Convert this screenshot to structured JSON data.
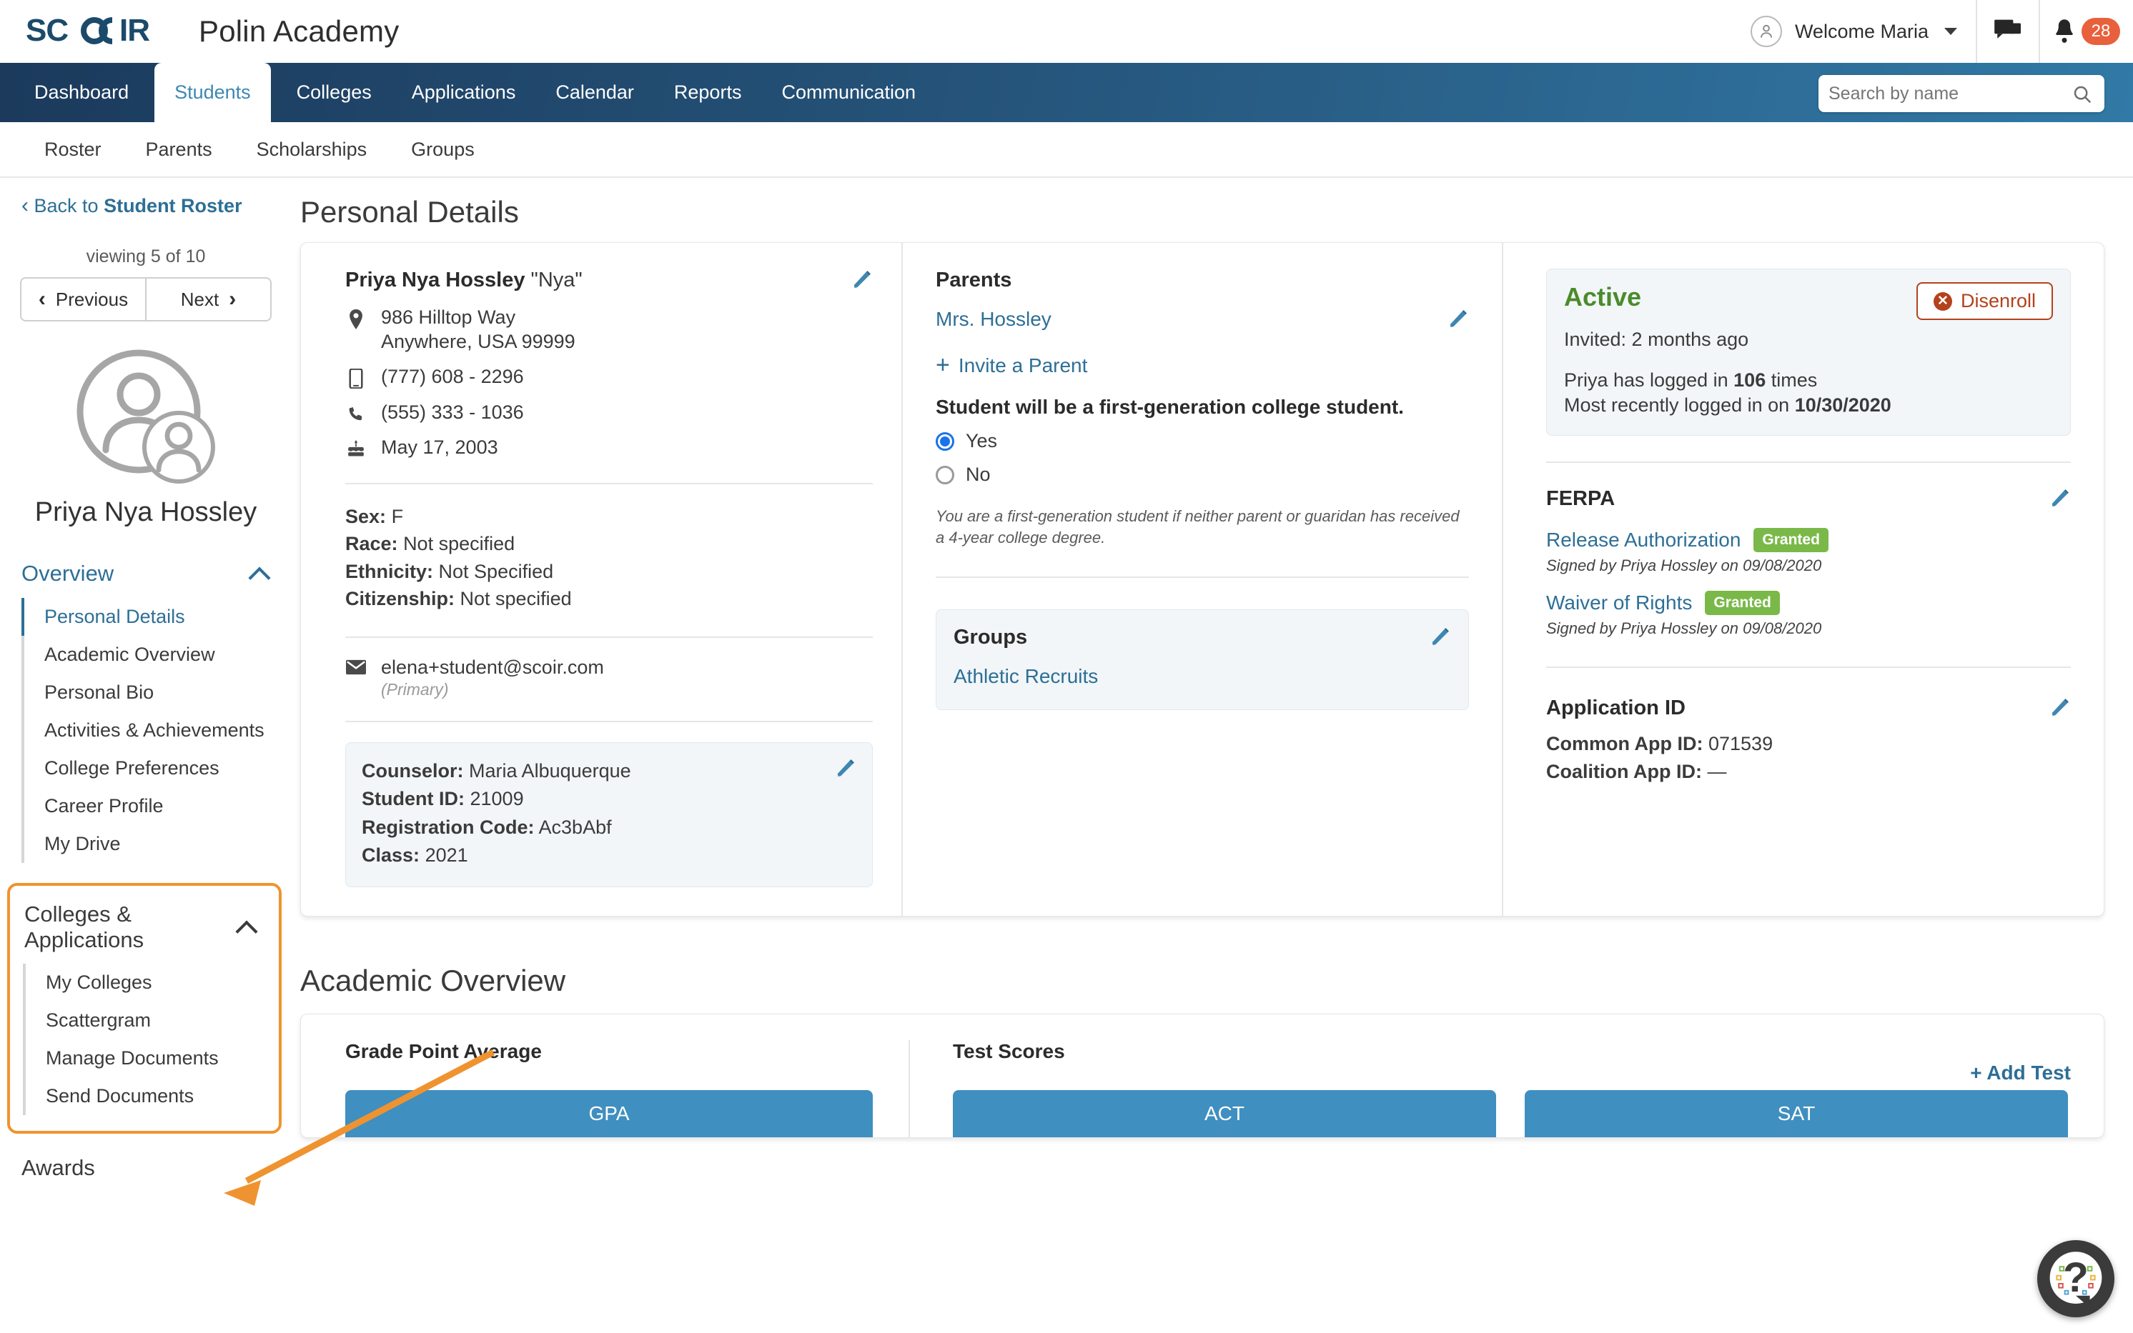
{
  "header": {
    "logo_text": "SCOIR",
    "school_name": "Polin Academy",
    "welcome_label": "Welcome Maria",
    "notification_count": "28",
    "icons": {
      "avatar": "user-avatar-icon",
      "messages": "chat-icon",
      "bell": "bell-icon"
    }
  },
  "search": {
    "placeholder": "Search by name",
    "value": ""
  },
  "main_nav": [
    {
      "label": "Dashboard",
      "active": false
    },
    {
      "label": "Students",
      "active": true
    },
    {
      "label": "Colleges",
      "active": false
    },
    {
      "label": "Applications",
      "active": false
    },
    {
      "label": "Calendar",
      "active": false
    },
    {
      "label": "Reports",
      "active": false
    },
    {
      "label": "Communication",
      "active": false
    }
  ],
  "sub_nav": [
    {
      "label": "Roster"
    },
    {
      "label": "Parents"
    },
    {
      "label": "Scholarships"
    },
    {
      "label": "Groups"
    }
  ],
  "sidebar": {
    "back_prefix": "Back to ",
    "back_target": "Student Roster",
    "viewing": "viewing 5 of 10",
    "previous_label": "Previous",
    "next_label": "Next",
    "student_name": "Priya Nya Hossley",
    "sections": [
      {
        "title": "Overview",
        "expanded": true,
        "items": [
          {
            "label": "Personal Details",
            "active": true
          },
          {
            "label": "Academic Overview",
            "active": false
          },
          {
            "label": "Personal Bio",
            "active": false
          },
          {
            "label": "Activities & Achievements",
            "active": false
          },
          {
            "label": "College Preferences",
            "active": false
          },
          {
            "label": "Career Profile",
            "active": false
          },
          {
            "label": "My Drive",
            "active": false
          }
        ]
      },
      {
        "title": "Colleges & Applications",
        "expanded": true,
        "highlighted": true,
        "items": [
          {
            "label": "My Colleges",
            "active": false
          },
          {
            "label": "Scattergram",
            "active": false
          },
          {
            "label": "Manage Documents",
            "active": false,
            "annotated": true
          },
          {
            "label": "Send Documents",
            "active": false
          }
        ]
      }
    ],
    "awards_label": "Awards"
  },
  "personal_details": {
    "page_title": "Personal Details",
    "name_main": "Priya Nya Hossley",
    "name_nick": "\"Nya\"",
    "address_line1": "986 Hilltop Way",
    "address_line2": "Anywhere, USA 99999",
    "mobile_phone": "(777) 608 - 2296",
    "home_phone": "(555) 333 - 1036",
    "birthday": "May 17, 2003",
    "sex_label": "Sex:",
    "sex_value": "F",
    "race_label": "Race:",
    "race_value": "Not specified",
    "ethnicity_label": "Ethnicity:",
    "ethnicity_value": "Not Specified",
    "citizenship_label": "Citizenship:",
    "citizenship_value": "Not specified",
    "email": "elena+student@scoir.com",
    "email_note": "(Primary)",
    "counselor_label": "Counselor:",
    "counselor_value": "Maria Albuquerque",
    "student_id_label": "Student ID:",
    "student_id_value": "21009",
    "registration_code_label": "Registration Code:",
    "registration_code_value": "Ac3bAbf",
    "class_label": "Class:",
    "class_value": "2021"
  },
  "parents": {
    "title": "Parents",
    "parent_name": "Mrs. Hossley",
    "invite_label": "Invite a Parent",
    "first_gen_question": "Student will be a first-generation college student.",
    "options": [
      {
        "label": "Yes",
        "selected": true
      },
      {
        "label": "No",
        "selected": false
      }
    ],
    "helper_text": "You are a first-generation student if neither parent or guaridan has received a 4-year college degree."
  },
  "groups": {
    "title": "Groups",
    "items": [
      "Athletic Recruits"
    ]
  },
  "status": {
    "state": "Active",
    "disenroll_label": "Disenroll",
    "invited_text": "Invited: 2 months ago",
    "login_prefix": "Priya has logged in ",
    "login_count": "106",
    "login_suffix": " times",
    "recent_prefix": "Most recently logged in on ",
    "recent_date": "10/30/2020"
  },
  "ferpa": {
    "title": "FERPA",
    "rows": [
      {
        "name": "Release Authorization",
        "badge": "Granted",
        "signed": "Signed by Priya Hossley on 09/08/2020"
      },
      {
        "name": "Waiver of Rights",
        "badge": "Granted",
        "signed": "Signed by Priya Hossley on 09/08/2020"
      }
    ]
  },
  "application_id": {
    "title": "Application ID",
    "common_app_label": "Common App ID:",
    "common_app_value": "071539",
    "coalition_label": "Coalition App ID:",
    "coalition_value": "—"
  },
  "academic_overview": {
    "title": "Academic Overview",
    "gpa_heading": "Grade Point Average",
    "gpa_bar_label": "GPA",
    "test_scores_heading": "Test Scores",
    "act_bar_label": "ACT",
    "sat_bar_label": "SAT",
    "add_test_label": "+ Add Test"
  },
  "help": {
    "label": "help-button"
  },
  "colors": {
    "accent_blue": "#2d6f96",
    "nav_dark": "#1b3a5c",
    "nav_light": "#3179a6",
    "annotation_orange": "#ef9330",
    "badge_green": "#7ab949",
    "active_green": "#4b8b2b",
    "disenroll_red": "#b3421d",
    "notif_orange": "#e8603c",
    "bar_blue": "#3f8fc0"
  }
}
